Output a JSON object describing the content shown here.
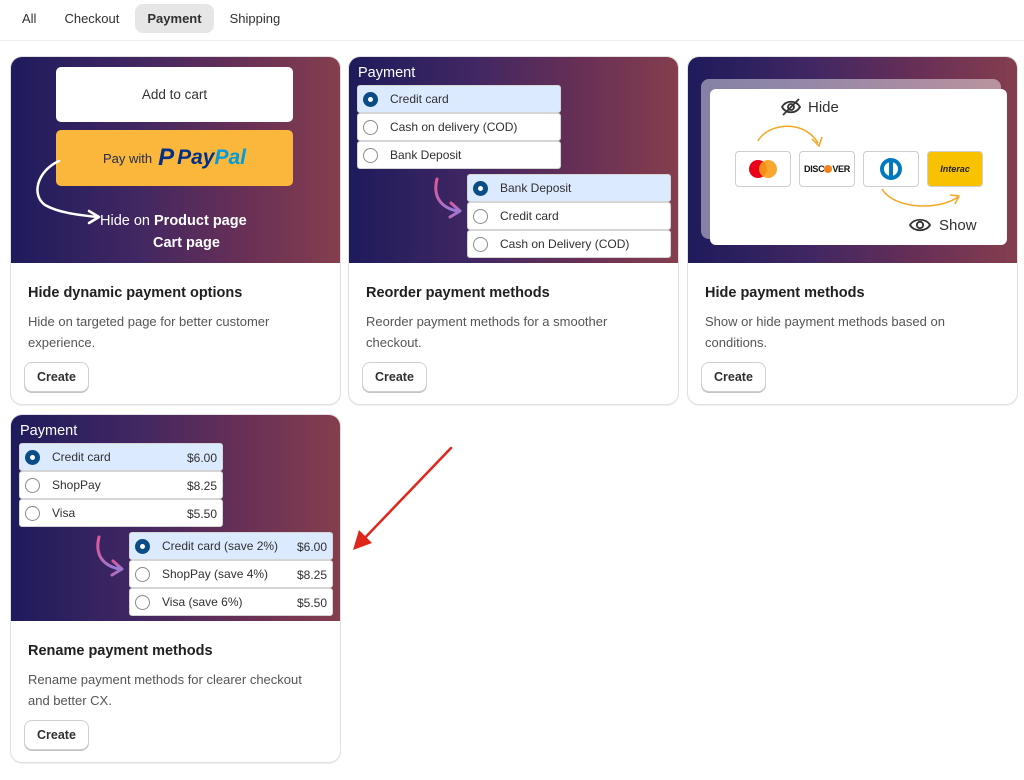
{
  "tabs": [
    {
      "label": "All",
      "active": false
    },
    {
      "label": "Checkout",
      "active": false
    },
    {
      "label": "Payment",
      "active": true
    },
    {
      "label": "Shipping",
      "active": false
    }
  ],
  "cards": [
    {
      "title": "Hide dynamic payment options",
      "description": "Hide on targeted page for better customer experience.",
      "button": "Create",
      "banner": {
        "add_to_cart": "Add to cart",
        "pay_with": "Pay with",
        "paypal_pay": "Pay",
        "paypal_pal": "Pal",
        "hide_on": "Hide on",
        "product_page": "Product page",
        "cart_page": "Cart page"
      }
    },
    {
      "title": "Reorder payment methods",
      "description": "Reorder payment methods for a smoother checkout.",
      "button": "Create",
      "banner": {
        "heading": "Payment",
        "before": [
          "Credit card",
          "Cash on delivery (COD)",
          "Bank Deposit"
        ],
        "after": [
          "Bank Deposit",
          "Credit card",
          "Cash on Delivery (COD)"
        ]
      }
    },
    {
      "title": "Hide payment methods",
      "description": "Show or hide payment methods based on conditions.",
      "button": "Create",
      "banner": {
        "hide_label": "Hide",
        "show_label": "Show",
        "discover": "DISC",
        "discover_end": "VER",
        "interac": "Interac"
      }
    },
    {
      "title": "Rename payment methods",
      "description": "Rename payment methods for clearer checkout and better CX.",
      "button": "Create",
      "banner": {
        "heading": "Payment",
        "before": [
          {
            "label": "Credit card",
            "price": "$6.00"
          },
          {
            "label": "ShopPay",
            "price": "$8.25"
          },
          {
            "label": "Visa",
            "price": "$5.50"
          }
        ],
        "after": [
          {
            "label": "Credit card (save 2%)",
            "price": "$6.00"
          },
          {
            "label": "ShopPay (save 4%)",
            "price": "$8.25"
          },
          {
            "label": "Visa (save 6%)",
            "price": "$5.50"
          }
        ]
      }
    }
  ],
  "colors": {
    "banner_start": "#1e1b5c",
    "banner_end": "#853f4e",
    "paypal_yellow": "#fbb73c",
    "radio_selected": "#0a4c86",
    "annotation_arrow": "#e0251b"
  },
  "icons": {
    "hide": "eye-slash-icon",
    "show": "eye-icon",
    "reorder_arrow": "curved-arrow-icon",
    "annotation": "red-arrow-icon"
  }
}
